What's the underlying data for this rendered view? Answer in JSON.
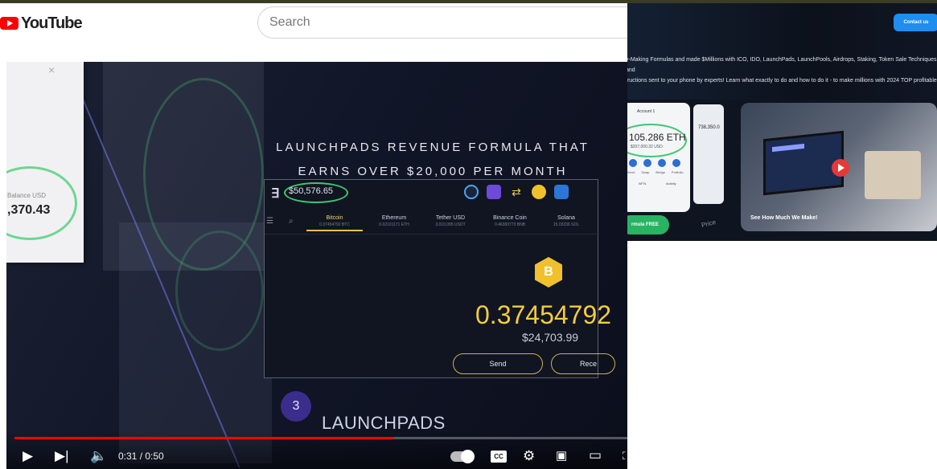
{
  "youtube": {
    "logo_text": "YouTube",
    "search_placeholder": "Search",
    "popup": {
      "close": "×",
      "small_label": "Balance USD",
      "amount": ",370.43"
    },
    "video": {
      "headline_line1": "LAUNCHPADS REVENUE FORMULA THAT",
      "headline_line2": "EARNS OVER $20,000 PER MONTH",
      "wallet": {
        "balance": "$50,576.65",
        "tabs": [
          {
            "name": "Bitcoin",
            "sub": "0.37454792 BTC"
          },
          {
            "name": "Ethereum",
            "sub": "0.02101171 ETH"
          },
          {
            "name": "Tether USD",
            "sub": "3,010,095 USDT"
          },
          {
            "name": "Binance Coin",
            "sub": "0.46383773 BNB"
          },
          {
            "name": "Solana",
            "sub": "15.03336 SOL"
          }
        ],
        "coin_symbol": "B",
        "amount": "0.37454792",
        "amount_usd": "$24,703.99",
        "send": "Send",
        "receive": "Rece"
      },
      "step_number": "3",
      "caption": "LAUNCHPADS",
      "time": "0:31 / 0:50",
      "progress": 0.62,
      "cc_label": "CC"
    }
  },
  "landing": {
    "contact_button": "Contact us",
    "description_line1": "y-Making Formulas and made $Millions with ICO, IDO, LaunchPads, LaunchPools, Airdrops, Staking, Token Sale Techniques and",
    "description_line2": "tructions sent to your phone by experts! Learn what exactly to do and how to do it - to make millions with 2024 TOP profitable",
    "phone": {
      "account": "Account 1",
      "eth_amount": "105.286 ETH",
      "eth_usd": "$207,000.32 USD",
      "actions": [
        "Send",
        "Swap",
        "Bridge",
        "Portfolio"
      ],
      "tab_nfts": "NFTs",
      "tab_activity": "Activity",
      "second_value": "738,350.0"
    },
    "cta_button": "rmula FREE",
    "video_caption": "See How Much We Make!",
    "price_word": "Price"
  }
}
